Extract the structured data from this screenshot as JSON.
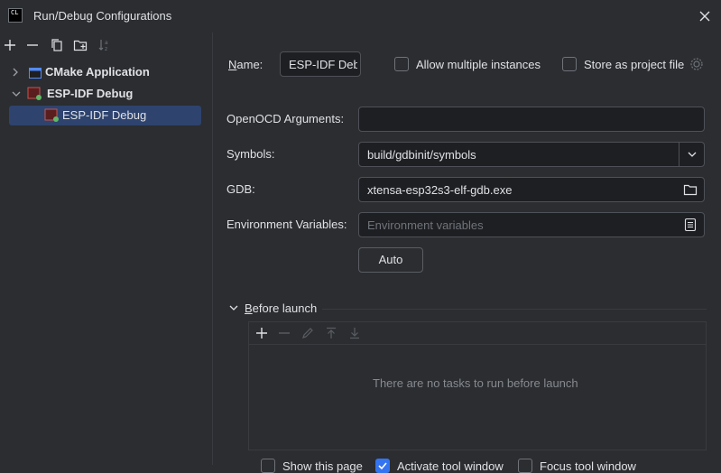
{
  "window": {
    "title": "Run/Debug Configurations",
    "app_icon_text": "CL"
  },
  "tree": {
    "items": [
      {
        "label": "CMake Application",
        "bold": true,
        "expanded": false
      },
      {
        "label": "ESP-IDF Debug",
        "bold": true,
        "expanded": true
      },
      {
        "label": "ESP-IDF Debug",
        "bold": false,
        "selected": true
      }
    ]
  },
  "form": {
    "name_label": "Name:",
    "name_value": "ESP-IDF Debug",
    "allow_multiple_label": "Allow multiple instances",
    "store_as_project_label": "Store as project file",
    "openocd_label": "OpenOCD Arguments:",
    "openocd_value": "",
    "symbols_label": "Symbols:",
    "symbols_value": "build/gdbinit/symbols",
    "gdb_label": "GDB:",
    "gdb_value": "xtensa-esp32s3-elf-gdb.exe",
    "env_label": "Environment Variables:",
    "env_placeholder": "Environment variables",
    "auto_button": "Auto"
  },
  "before_launch": {
    "title": "Before launch",
    "empty_text": "There are no tasks to run before launch"
  },
  "bottom_options": [
    {
      "label": "Show this page",
      "checked": false
    },
    {
      "label": "Activate tool window",
      "checked": true
    },
    {
      "label": "Focus tool window",
      "checked": false
    }
  ],
  "colors": {
    "accent": "#3574f0",
    "selection": "#2e436e",
    "background": "#2b2d30",
    "field": "#1e1f22"
  }
}
